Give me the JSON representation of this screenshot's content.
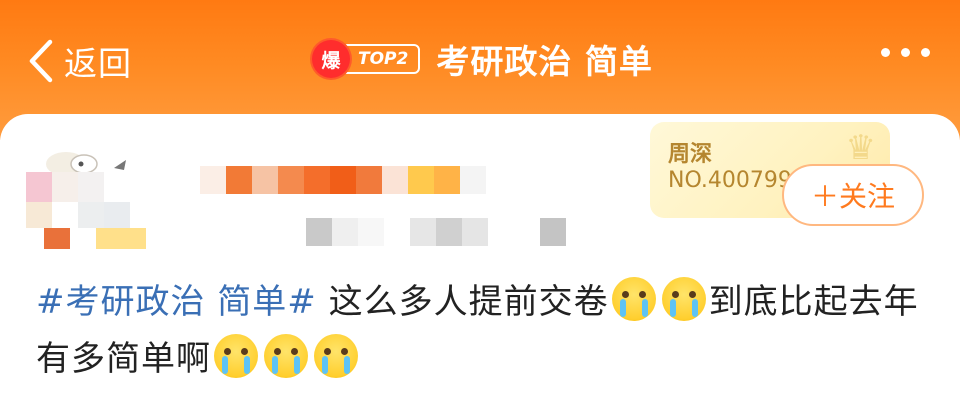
{
  "header": {
    "back_label": "返回",
    "hot_badge": "爆",
    "rank_tag": "TOP2",
    "title": "考研政治 简单",
    "more_icon": "more-dots-icon",
    "gradient_colors": [
      "#ff7a12",
      "#ff9c3e"
    ]
  },
  "profile": {
    "medal_name": "周深",
    "medal_no": "NO.400799",
    "follow_label": "＋关注",
    "accent": "#ff7a1e"
  },
  "post": {
    "topic": "#考研政治 简单#",
    "text_1": " 这么多人提前交卷",
    "text_2": "到底比起去年有多简单啊",
    "emoji_name": "crying-face-icon"
  }
}
